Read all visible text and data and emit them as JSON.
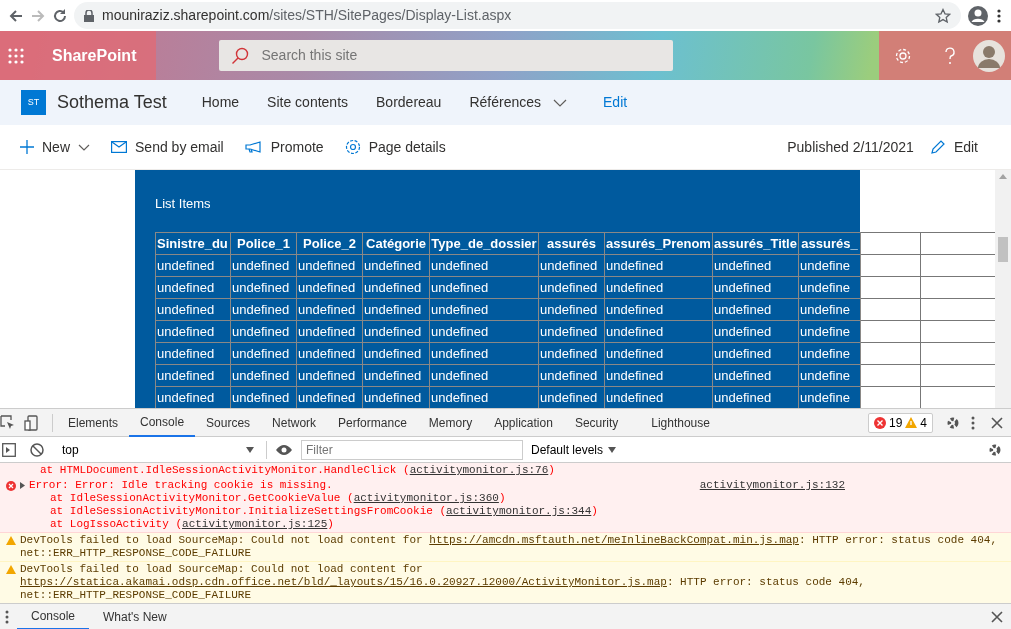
{
  "browser": {
    "url_host": "mouniraziz.sharepoint.com",
    "url_path": "/sites/STH/SitePages/Display-List.aspx"
  },
  "suite_bar": {
    "app_name": "SharePoint",
    "search_placeholder": "Search this site"
  },
  "site": {
    "logo": "ST",
    "title": "Sothema Test",
    "nav": [
      {
        "label": "Home",
        "kind": "link"
      },
      {
        "label": "Site contents",
        "kind": "link"
      },
      {
        "label": "Bordereau",
        "kind": "link"
      },
      {
        "label": "Références",
        "kind": "dropdown"
      },
      {
        "label": "Edit",
        "kind": "edit"
      }
    ]
  },
  "command_bar": {
    "actions": [
      {
        "label": "New",
        "kind": "new"
      },
      {
        "label": "Send by email",
        "kind": "email"
      },
      {
        "label": "Promote",
        "kind": "promote"
      },
      {
        "label": "Page details",
        "kind": "details"
      }
    ],
    "published": "Published 2/11/2021",
    "edit": "Edit"
  },
  "web_part": {
    "title": "List Items",
    "columns": [
      "Sinistre_du",
      "Police_1",
      "Police_2",
      "Catégorie",
      "Type_de_dossier",
      "assurés",
      "assurés_Prenom",
      "assurés_Title",
      "assurés_"
    ],
    "rows": [
      [
        "undefined",
        "undefined",
        "undefined",
        "undefined",
        "undefined",
        "undefined",
        "undefined",
        "undefined",
        "undefine"
      ],
      [
        "undefined",
        "undefined",
        "undefined",
        "undefined",
        "undefined",
        "undefined",
        "undefined",
        "undefined",
        "undefine"
      ],
      [
        "undefined",
        "undefined",
        "undefined",
        "undefined",
        "undefined",
        "undefined",
        "undefined",
        "undefined",
        "undefine"
      ],
      [
        "undefined",
        "undefined",
        "undefined",
        "undefined",
        "undefined",
        "undefined",
        "undefined",
        "undefined",
        "undefine"
      ],
      [
        "undefined",
        "undefined",
        "undefined",
        "undefined",
        "undefined",
        "undefined",
        "undefined",
        "undefined",
        "undefine"
      ],
      [
        "undefined",
        "undefined",
        "undefined",
        "undefined",
        "undefined",
        "undefined",
        "undefined",
        "undefined",
        "undefine"
      ],
      [
        "undefined",
        "undefined",
        "undefined",
        "undefined",
        "undefined",
        "undefined",
        "undefined",
        "undefined",
        "undefine"
      ]
    ]
  },
  "devtools": {
    "tabs": [
      {
        "label": "Elements",
        "selected": false
      },
      {
        "label": "Console",
        "selected": true
      },
      {
        "label": "Sources",
        "selected": false
      },
      {
        "label": "Network",
        "selected": false
      },
      {
        "label": "Performance",
        "selected": false
      },
      {
        "label": "Memory",
        "selected": false
      },
      {
        "label": "Application",
        "selected": false
      },
      {
        "label": "Security",
        "selected": false
      },
      {
        "label": "Lighthouse",
        "selected": false
      }
    ],
    "error_count": "19",
    "warning_count": "4",
    "context": "top",
    "filter_placeholder": "Filter",
    "levels": "Default levels",
    "messages": [
      {
        "kind": "trace",
        "lines": [
          {
            "text": "at HTMLDocument.IdleSessionActivityMonitor.HandleClick (",
            "link": "activitymonitor.js:76",
            "after": ")"
          }
        ]
      },
      {
        "kind": "error",
        "text": "Error: Error: Idle tracking cookie is missing.",
        "source": "activitymonitor.js:132",
        "lines": [
          {
            "text": "at IdleSessionActivityMonitor.GetCookieValue (",
            "link": "activitymonitor.js:360",
            "after": ")"
          },
          {
            "text": "at IdleSessionActivityMonitor.InitializeSettingsFromCookie (",
            "link": "activitymonitor.js:344",
            "after": ")"
          },
          {
            "text": "at LogIssoActivity (",
            "link": "activitymonitor.js:125",
            "after": ")"
          }
        ]
      },
      {
        "kind": "warning",
        "text": "DevTools failed to load SourceMap: Could not load content for ",
        "link": "https://amcdn.msftauth.net/meInlineBackCompat.min.js.map",
        "after": ": HTTP error: status code 404, net::ERR_HTTP_RESPONSE_CODE_FAILURE"
      },
      {
        "kind": "warning",
        "text": "DevTools failed to load SourceMap: Could not load content for ",
        "link": "https://statica.akamai.odsp.cdn.office.net/bld/_layouts/15/16.0.20927.12000/ActivityMonitor.js.map",
        "after": ": HTTP error: status code 404, net::ERR_HTTP_RESPONSE_CODE_FAILURE"
      }
    ],
    "drawer_tabs": [
      {
        "label": "Console",
        "selected": true
      },
      {
        "label": "What's New",
        "selected": false
      }
    ]
  }
}
